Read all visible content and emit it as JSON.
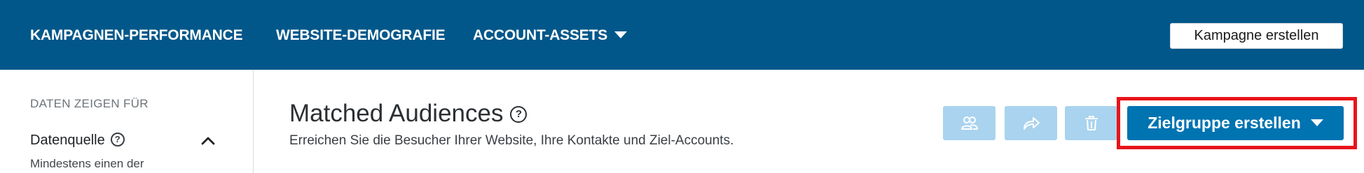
{
  "nav": {
    "items": [
      {
        "label": "KAMPAGNEN-PERFORMANCE"
      },
      {
        "label": "WEBSITE-DEMOGRAFIE"
      },
      {
        "label": "ACCOUNT-ASSETS"
      }
    ],
    "create_campaign_label": "Kampagne erstellen"
  },
  "sidebar": {
    "heading": "DATEN ZEIGEN FÜR",
    "datasource_label": "Datenquelle",
    "datasource_desc": "Mindestens einen der"
  },
  "main": {
    "title": "Matched Audiences",
    "subtitle": "Erreichen Sie die Besucher Ihrer Website, Ihre Kontakte und Ziel-Accounts.",
    "create_audience_label": "Zielgruppe erstellen"
  },
  "icons": {
    "help": "question-circle-icon",
    "dropdown": "caret-down-icon",
    "collapse": "chevron-up-icon",
    "audience": "users-icon",
    "share": "share-arrow-icon",
    "delete": "trash-icon"
  },
  "colors": {
    "nav_background": "#02578a",
    "primary_button": "#0073b1",
    "disabled_button": "#a9d3ee",
    "highlight_border": "#e8141b"
  }
}
